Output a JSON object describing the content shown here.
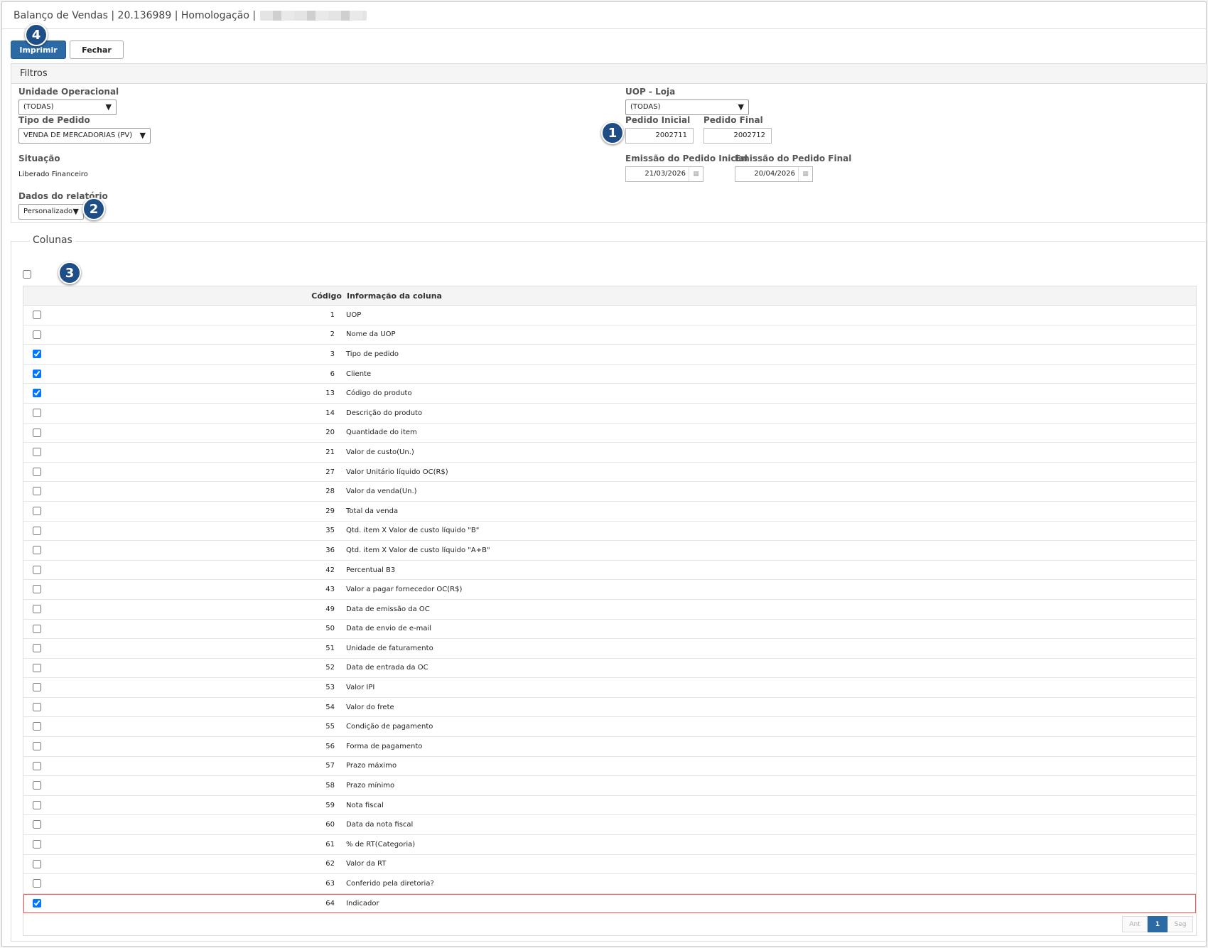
{
  "window": {
    "title": "Balanço de Vendas | 20.136989 | Homologação |"
  },
  "toolbar": {
    "print_label": "Imprimir",
    "close_label": "Fechar"
  },
  "badges": [
    "1",
    "2",
    "3",
    "4"
  ],
  "filters": {
    "header": "Filtros",
    "unidade_label": "Unidade Operacional",
    "unidade_value": "(TODAS)",
    "uop_loja_label": "UOP - Loja",
    "uop_loja_value": "(TODAS)",
    "tipo_pedido_label": "Tipo de Pedido",
    "tipo_pedido_value": "VENDA DE MERCADORIAS (PV)",
    "pedido_inicial_label": "Pedido Inicial",
    "pedido_inicial_value": "2002711",
    "pedido_final_label": "Pedido Final",
    "pedido_final_value": "2002712",
    "situacao_label": "Situação",
    "situacao_value": "Liberado Financeiro",
    "emissao_inicial_label": "Emissão do Pedido Inicial",
    "emissao_inicial_value": "21/03/2026",
    "emissao_final_label": "Emissão do Pedido Final",
    "emissao_final_value": "20/04/2026",
    "dados_label": "Dados do relatório",
    "dados_value": "Personalizado"
  },
  "columns_panel": {
    "legend": "Colunas",
    "header_code": "Código",
    "header_info": "Informação da coluna",
    "rows": [
      {
        "code": "1",
        "info": "UOP",
        "checked": false
      },
      {
        "code": "2",
        "info": "Nome da UOP",
        "checked": false
      },
      {
        "code": "3",
        "info": "Tipo de pedido",
        "checked": true
      },
      {
        "code": "6",
        "info": "Cliente",
        "checked": true
      },
      {
        "code": "13",
        "info": "Código do produto",
        "checked": true
      },
      {
        "code": "14",
        "info": "Descrição do produto",
        "checked": false
      },
      {
        "code": "20",
        "info": "Quantidade do item",
        "checked": false
      },
      {
        "code": "21",
        "info": "Valor de custo(Un.)",
        "checked": false
      },
      {
        "code": "27",
        "info": "Valor Unitário líquido OC(R$)",
        "checked": false
      },
      {
        "code": "28",
        "info": "Valor da venda(Un.)",
        "checked": false
      },
      {
        "code": "29",
        "info": "Total da venda",
        "checked": false
      },
      {
        "code": "35",
        "info": "Qtd. item X Valor de custo líquido \"B\"",
        "checked": false
      },
      {
        "code": "36",
        "info": "Qtd. item X Valor de custo líquido \"A+B\"",
        "checked": false
      },
      {
        "code": "42",
        "info": "Percentual B3",
        "checked": false
      },
      {
        "code": "43",
        "info": "Valor a pagar fornecedor OC(R$)",
        "checked": false
      },
      {
        "code": "49",
        "info": "Data de emissão da OC",
        "checked": false
      },
      {
        "code": "50",
        "info": "Data de envio de e-mail",
        "checked": false
      },
      {
        "code": "51",
        "info": "Unidade de faturamento",
        "checked": false
      },
      {
        "code": "52",
        "info": "Data de entrada da OC",
        "checked": false
      },
      {
        "code": "53",
        "info": "Valor IPI",
        "checked": false
      },
      {
        "code": "54",
        "info": "Valor do frete",
        "checked": false
      },
      {
        "code": "55",
        "info": "Condição de pagamento",
        "checked": false
      },
      {
        "code": "56",
        "info": "Forma de pagamento",
        "checked": false
      },
      {
        "code": "57",
        "info": "Prazo máximo",
        "checked": false
      },
      {
        "code": "58",
        "info": "Prazo mínimo",
        "checked": false
      },
      {
        "code": "59",
        "info": "Nota fiscal",
        "checked": false
      },
      {
        "code": "60",
        "info": "Data da nota fiscal",
        "checked": false
      },
      {
        "code": "61",
        "info": "% de RT(Categoria)",
        "checked": false
      },
      {
        "code": "62",
        "info": "Valor da RT",
        "checked": false
      },
      {
        "code": "63",
        "info": "Conferido pela diretoria?",
        "checked": false
      },
      {
        "code": "64",
        "info": "Indicador",
        "checked": true
      }
    ],
    "highlighted_row_code": "64",
    "highlight_color": "#e35a5a"
  },
  "pagination": {
    "prev_label": "Ant",
    "current_page": "1",
    "next_label": "Seg"
  },
  "colors": {
    "primary": "#2c6aa6",
    "badge": "#1f4e86"
  },
  "icons": {
    "select_caret": "chevron-down-icon",
    "date_picker": "calendar-icon"
  }
}
